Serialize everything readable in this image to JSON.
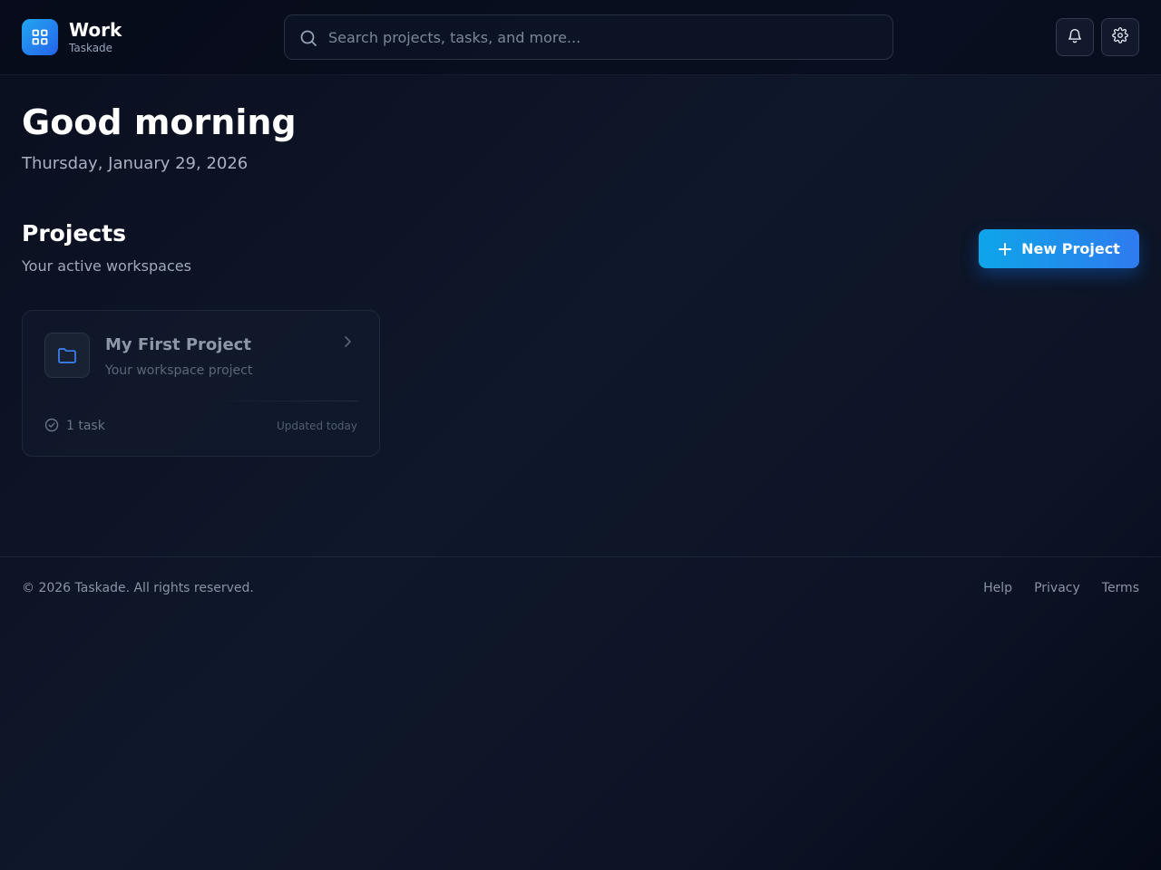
{
  "header": {
    "brand_title": "Work",
    "brand_subtitle": "Taskade",
    "brand_icon": "grid-icon",
    "search_placeholder": "Search projects, tasks, and more...",
    "search_value": "",
    "notification_icon": "bell-icon",
    "settings_icon": "gear-icon"
  },
  "greeting": {
    "title": "Good morning",
    "date": "Thursday, January 29, 2026"
  },
  "projects": {
    "title": "Projects",
    "subtitle": "Your active workspaces",
    "new_button_label": "New Project",
    "items": [
      {
        "name": "My First Project",
        "description": "Your workspace project",
        "task_count": "1 task",
        "updated": "Updated today",
        "icon": "folder-icon"
      }
    ]
  },
  "footer": {
    "copyright": "© 2026 Taskade. All rights reserved.",
    "links": [
      "Help",
      "Privacy",
      "Terms"
    ]
  },
  "colors": {
    "accent": "#2f7bef",
    "accent_light": "#0ea5e9",
    "background": "#0f172a"
  }
}
